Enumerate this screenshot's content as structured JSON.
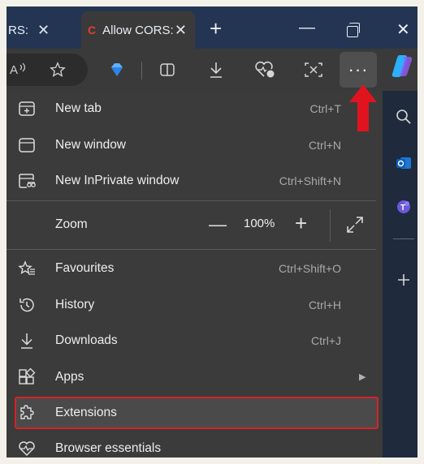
{
  "tabs": [
    {
      "title": "RS:",
      "close": "✕"
    },
    {
      "favicon": "C",
      "title": "Allow CORS:",
      "close": "✕"
    }
  ],
  "tabstrip": {
    "new_tab": "+"
  },
  "window": {
    "minimize": "—",
    "close": "✕"
  },
  "toolbar": {
    "more_label": "···"
  },
  "menu": {
    "items": [
      {
        "label": "New tab",
        "shortcut": "Ctrl+T",
        "icon": "new-tab-icon"
      },
      {
        "label": "New window",
        "shortcut": "Ctrl+N",
        "icon": "window-icon"
      },
      {
        "label": "New InPrivate window",
        "shortcut": "Ctrl+Shift+N",
        "icon": "inprivate-icon"
      },
      {
        "label": "Favourites",
        "shortcut": "Ctrl+Shift+O",
        "icon": "favourites-icon"
      },
      {
        "label": "History",
        "shortcut": "Ctrl+H",
        "icon": "history-icon"
      },
      {
        "label": "Downloads",
        "shortcut": "Ctrl+J",
        "icon": "download-icon"
      },
      {
        "label": "Apps",
        "shortcut": "",
        "icon": "apps-icon"
      },
      {
        "label": "Extensions",
        "shortcut": "",
        "icon": "extensions-icon"
      },
      {
        "label": "Browser essentials",
        "shortcut": "",
        "icon": "heart-pulse-icon"
      }
    ],
    "zoom": {
      "label": "Zoom",
      "value": "100%",
      "minus": "—",
      "plus": "+"
    }
  },
  "colors": {
    "highlight_border": "#d8222a",
    "annotation_arrow": "#e0141e",
    "menu_bg": "#3b3b3b",
    "tabstrip_bg": "#243554"
  }
}
